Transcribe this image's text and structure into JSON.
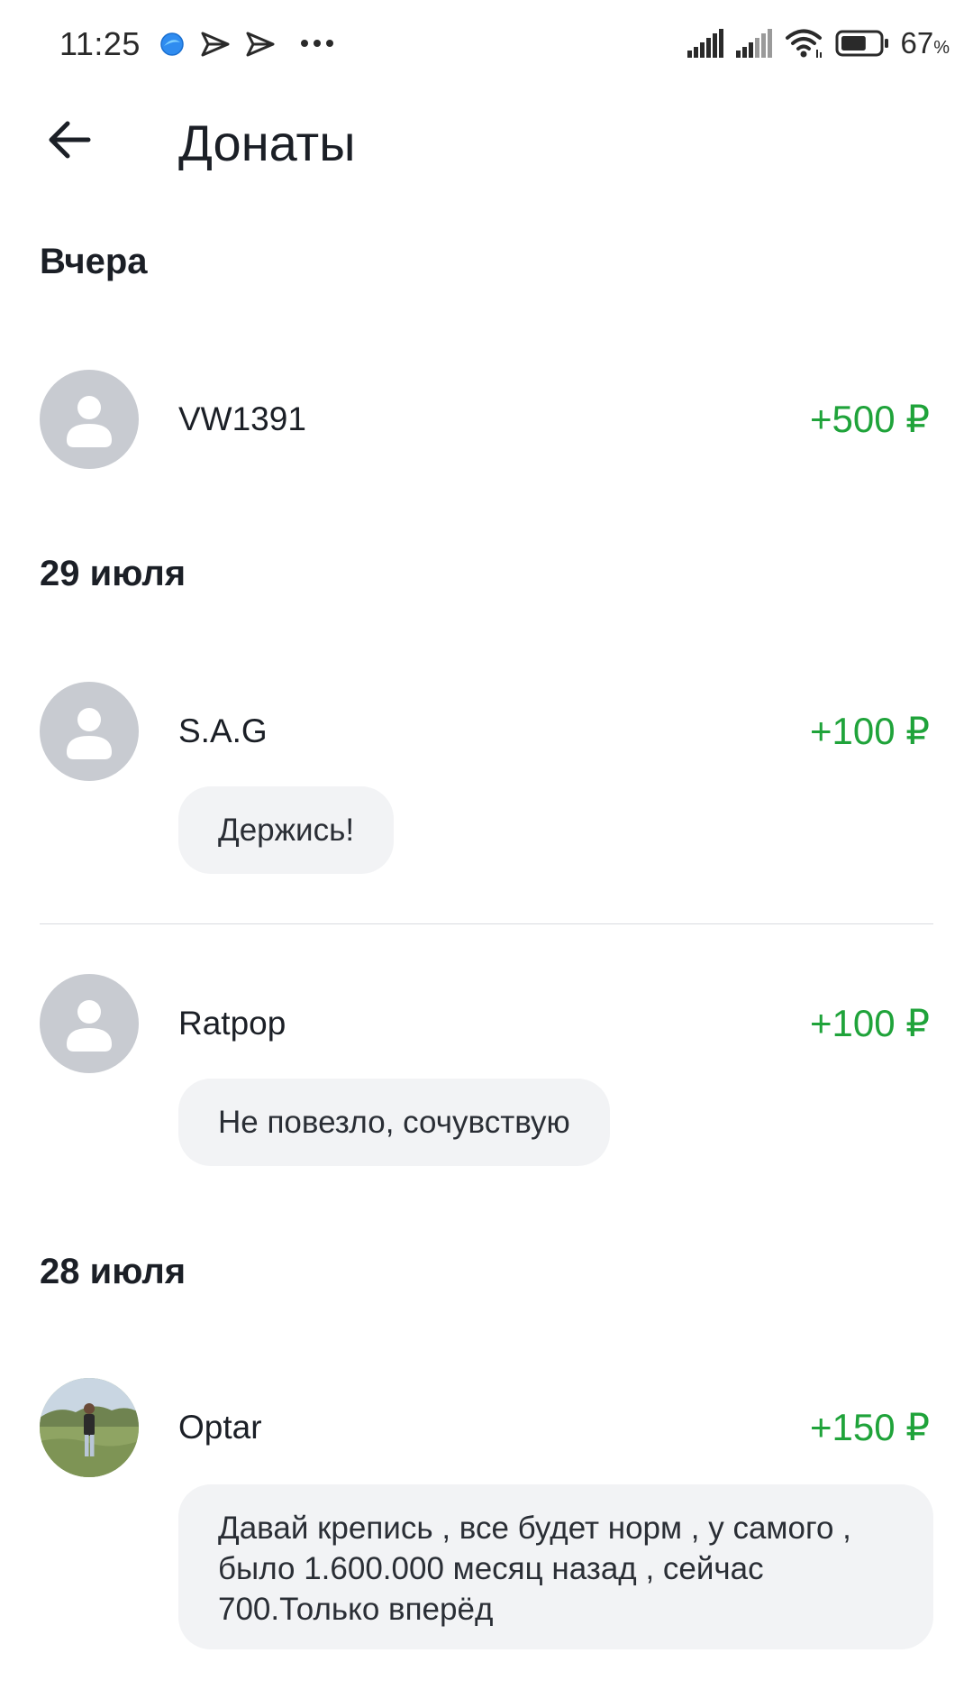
{
  "status_bar": {
    "time": "11:25",
    "battery_percent": "67",
    "battery_unit": "%",
    "battery_level": 0.67,
    "icons": [
      "browser-icon",
      "send-icon",
      "send-icon",
      "more-icon",
      "signal-icon",
      "signal-icon",
      "wifi-icon",
      "battery-icon"
    ]
  },
  "header": {
    "title": "Донаты",
    "back_icon": "arrow-left-icon"
  },
  "colors": {
    "amount_green": "#1fa33a",
    "avatar_placeholder": "#c8cbd1",
    "message_bg": "#f2f3f5"
  },
  "groups": [
    {
      "date": "Вчера",
      "donations": [
        {
          "name": "VW1391",
          "amount": "+500 ₽",
          "message": ""
        }
      ]
    },
    {
      "date": "29 июля",
      "donations": [
        {
          "name": "S.A.G",
          "amount": "+100 ₽",
          "message": "Держись!"
        },
        {
          "name": "Ratpop",
          "amount": "+100 ₽",
          "message": "Не повезло, сочувствую"
        }
      ]
    },
    {
      "date": "28 июля",
      "donations": [
        {
          "name": "Optar",
          "amount": "+150 ₽",
          "message": "Давай крепись , все будет норм , у самого , было 1.600.000 месяц назад , сейчас 700.Только вперёд"
        }
      ]
    }
  ]
}
